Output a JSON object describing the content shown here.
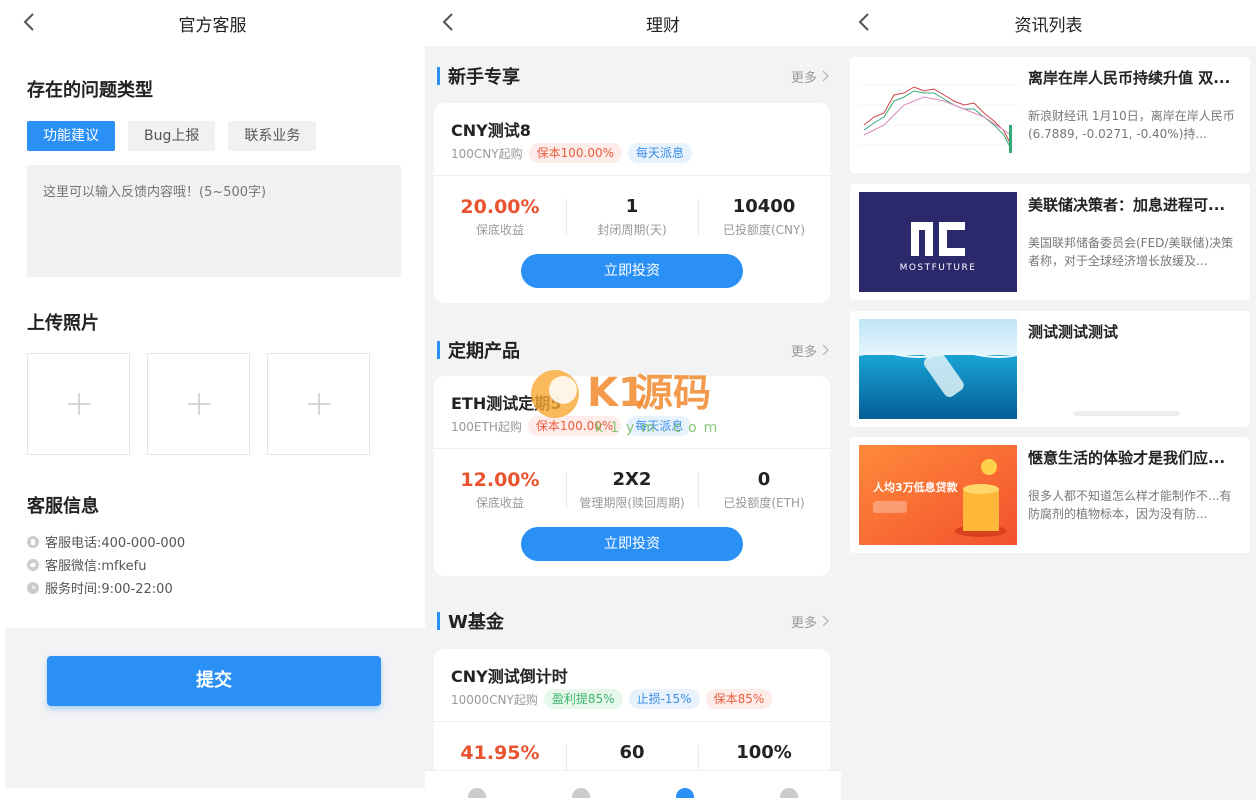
{
  "service": {
    "nav_title": "官方客服",
    "issue_type_title": "存在的问题类型",
    "issue_types": [
      "功能建议",
      "Bug上报",
      "联系业务"
    ],
    "feedback_placeholder": "这里可以输入反馈内容哦！(5~500字)",
    "upload_title": "上传照片",
    "info_title": "客服信息",
    "phone": "客服电话:400-000-000",
    "wechat": "客服微信:mfkefu",
    "hours": "服务时间:9:00-22:00",
    "submit_label": "提交"
  },
  "finance": {
    "nav_title": "理财",
    "more_label": "更多",
    "sections": [
      {
        "name": "新手专享",
        "product": {
          "name": "CNY测试8",
          "min": "100CNY起购",
          "badges": [
            "保本100.00%",
            "每天派息"
          ],
          "stats": [
            {
              "value": "20.00%",
              "label": "保底收益"
            },
            {
              "value": "1",
              "label": "封闭周期(天)"
            },
            {
              "value": "10400",
              "label": "已投额度(CNY)"
            }
          ],
          "button": "立即投资"
        }
      },
      {
        "name": "定期产品",
        "product": {
          "name": "ETH测试定期5",
          "min": "100ETH起购",
          "badges": [
            "保本100.00%",
            "每天派息"
          ],
          "stats": [
            {
              "value": "12.00%",
              "label": "保底收益"
            },
            {
              "value": "2X2",
              "label": "管理期限(赎回周期)"
            },
            {
              "value": "0",
              "label": "已投额度(ETH)"
            }
          ],
          "button": "立即投资"
        }
      },
      {
        "name": "W基金",
        "product": {
          "name": "CNY测试倒计时",
          "min": "10000CNY起购",
          "badges": [
            "盈利提85%",
            "止损-15%",
            "保本85%"
          ],
          "stats": [
            {
              "value": "41.95%",
              "label": ""
            },
            {
              "value": "60",
              "label": ""
            },
            {
              "value": "100%",
              "label": ""
            }
          ]
        }
      }
    ],
    "watermark": {
      "brand": "K1源码",
      "url": "k1ym.com"
    }
  },
  "news": {
    "nav_title": "资讯列表",
    "items": [
      {
        "title": "离岸在岸人民币持续升值 双...",
        "desc": "新浪财经讯 1月10日，离岸在岸人民币(6.7889, -0.0271, -0.40%)持..."
      },
      {
        "title": "美联储决策者：加息进程可...",
        "desc": "美国联邦储备委员会(FED/美联储)决策者称，对于全球经济增长放缓及...",
        "logo_text": "MOSTFUTURE"
      },
      {
        "title": "测试测试测试",
        "desc": ""
      },
      {
        "title": "惬意生活的体验才是我们应...",
        "desc": "很多人都不知道怎么样才能制作不...有防腐剂的植物标本，因为没有防...",
        "banner_text": "人均3万低息贷款"
      }
    ]
  },
  "colors": {
    "primary": "#2b90f5",
    "profit": "#e9532f",
    "background": "#f2f3f5"
  }
}
